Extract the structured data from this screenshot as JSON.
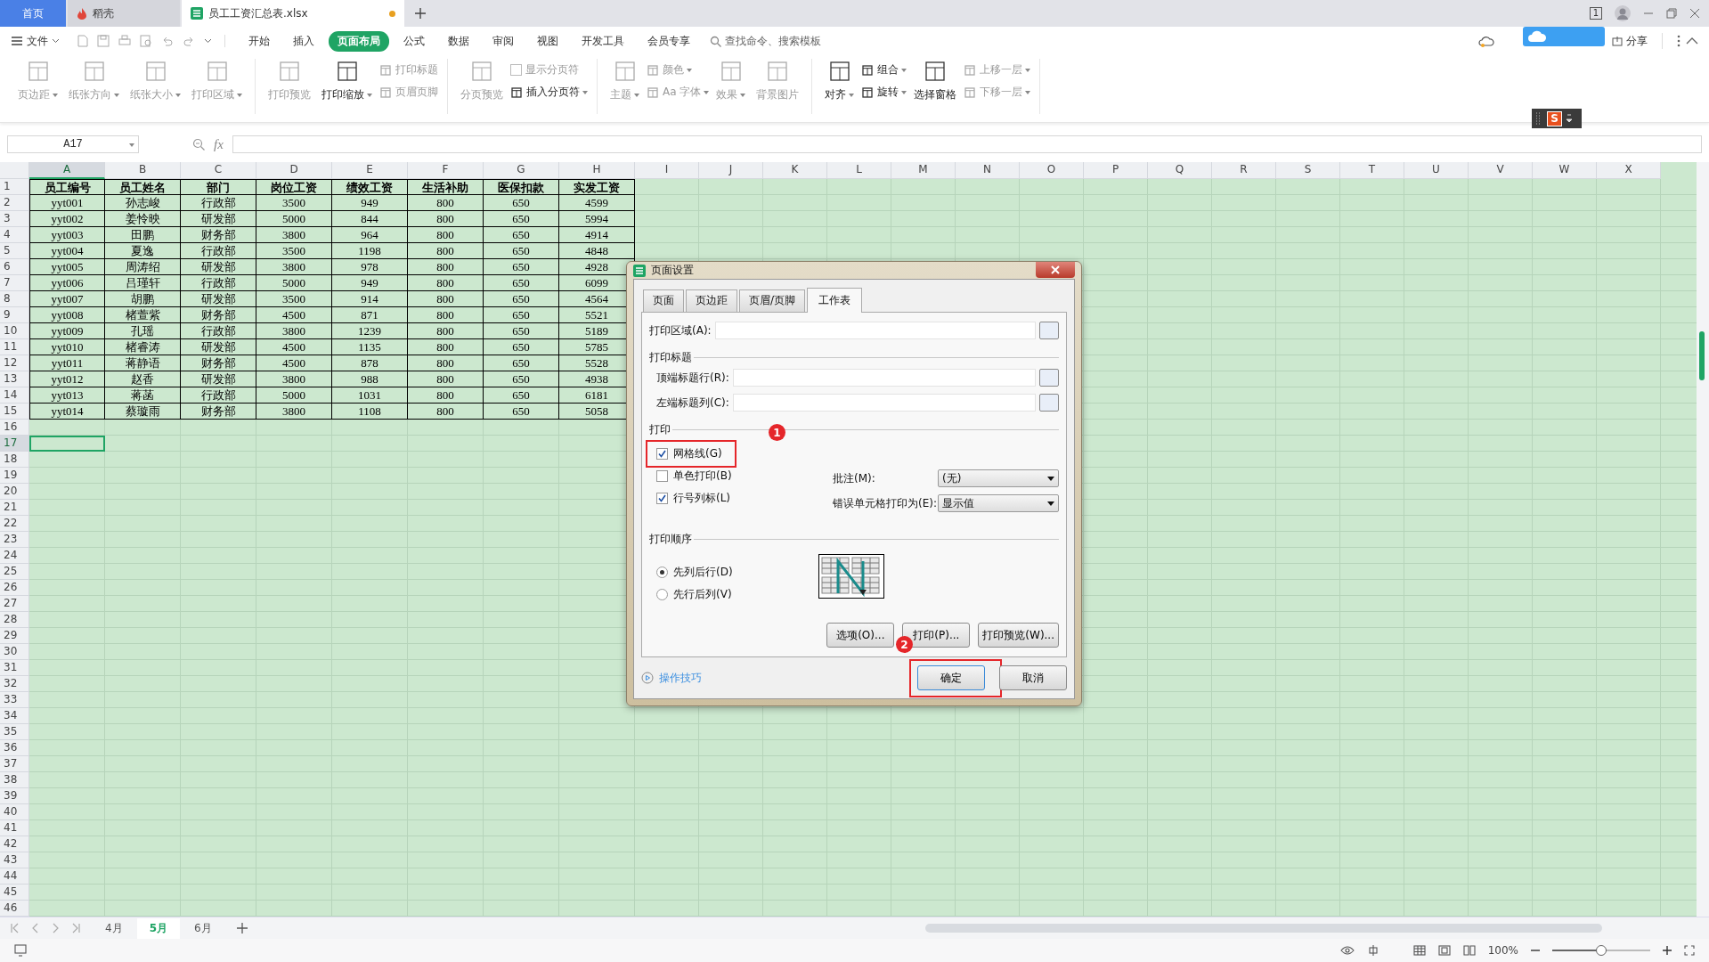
{
  "app_tabs": [
    {
      "label": "首页",
      "kind": "home",
      "selected": false
    },
    {
      "label": "稻壳",
      "kind": "docer",
      "selected": false
    },
    {
      "label": "员工工资汇总表.xlsx",
      "kind": "sheet",
      "selected": true
    }
  ],
  "window_count": "1",
  "menu": {
    "file": "文件",
    "tabs": [
      {
        "label": "开始",
        "selected": false
      },
      {
        "label": "插入",
        "selected": false
      },
      {
        "label": "页面布局",
        "selected": true
      },
      {
        "label": "公式",
        "selected": false
      },
      {
        "label": "数据",
        "selected": false
      },
      {
        "label": "审阅",
        "selected": false
      },
      {
        "label": "视图",
        "selected": false
      },
      {
        "label": "开发工具",
        "selected": false
      },
      {
        "label": "会员专享",
        "selected": false
      }
    ],
    "search_placeholder": "查找命令、搜索模板",
    "share": "分享"
  },
  "ime_badge": "S",
  "ribbon": [
    {
      "items": [
        {
          "kind": "large",
          "label": "页边距",
          "disabled": true,
          "dropdown": true
        },
        {
          "kind": "large",
          "label": "纸张方向",
          "disabled": true,
          "dropdown": true
        },
        {
          "kind": "large",
          "label": "纸张大小",
          "disabled": true,
          "dropdown": true
        },
        {
          "kind": "large",
          "label": "打印区域",
          "disabled": true,
          "dropdown": true
        }
      ]
    },
    {
      "items": [
        {
          "kind": "large",
          "label": "打印预览",
          "disabled": true,
          "dropdown": false
        },
        {
          "kind": "large",
          "label": "打印缩放",
          "disabled": false,
          "dropdown": true
        },
        {
          "kind": "stack",
          "items": [
            {
              "kind": "small",
              "label": "打印标题",
              "disabled": true,
              "dropdown": false
            },
            {
              "kind": "small",
              "label": "页眉页脚",
              "disabled": true,
              "dropdown": false
            }
          ]
        }
      ]
    },
    {
      "items": [
        {
          "kind": "large",
          "label": "分页预览",
          "disabled": true,
          "dropdown": false
        },
        {
          "kind": "stack",
          "items": [
            {
              "kind": "check",
              "label": "显示分页符",
              "disabled": true,
              "dropdown": false,
              "checked": false
            },
            {
              "kind": "small",
              "label": "插入分页符",
              "disabled": false,
              "dropdown": true
            }
          ]
        }
      ]
    },
    {
      "items": [
        {
          "kind": "large",
          "label": "主题",
          "disabled": true,
          "dropdown": true
        },
        {
          "kind": "stack",
          "items": [
            {
              "kind": "small",
              "label": "颜色",
              "disabled": true,
              "dropdown": true
            },
            {
              "kind": "small",
              "label": "Aa 字体",
              "disabled": true,
              "dropdown": true
            }
          ]
        },
        {
          "kind": "large",
          "label": "效果",
          "disabled": true,
          "dropdown": true
        },
        {
          "kind": "large",
          "label": "背景图片",
          "disabled": true,
          "dropdown": false
        }
      ]
    },
    {
      "items": [
        {
          "kind": "large",
          "label": "对齐",
          "disabled": false,
          "dropdown": true
        },
        {
          "kind": "stack",
          "items": [
            {
              "kind": "small",
              "label": "组合",
              "disabled": false,
              "dropdown": true
            },
            {
              "kind": "small",
              "label": "旋转",
              "disabled": false,
              "dropdown": true
            }
          ]
        },
        {
          "kind": "large",
          "label": "选择窗格",
          "disabled": false,
          "dropdown": false
        },
        {
          "kind": "stack",
          "items": [
            {
              "kind": "small",
              "label": "上移一层",
              "disabled": true,
              "dropdown": true
            },
            {
              "kind": "small",
              "label": "下移一层",
              "disabled": true,
              "dropdown": true
            }
          ]
        }
      ]
    }
  ],
  "formula_bar": {
    "cell": "A17",
    "fx": "fx"
  },
  "sheet": {
    "columns": [
      {
        "label": "A",
        "selected": true
      },
      {
        "label": "B",
        "selected": false
      },
      {
        "label": "C",
        "selected": false
      },
      {
        "label": "D",
        "selected": false
      },
      {
        "label": "E",
        "selected": false
      },
      {
        "label": "F",
        "selected": false
      },
      {
        "label": "G",
        "selected": false
      },
      {
        "label": "H",
        "selected": false
      },
      {
        "label": "I",
        "selected": false
      },
      {
        "label": "J",
        "selected": false
      },
      {
        "label": "K",
        "selected": false
      },
      {
        "label": "L",
        "selected": false
      },
      {
        "label": "M",
        "selected": false
      },
      {
        "label": "N",
        "selected": false
      },
      {
        "label": "O",
        "selected": false
      },
      {
        "label": "P",
        "selected": false
      },
      {
        "label": "Q",
        "selected": false
      },
      {
        "label": "R",
        "selected": false
      },
      {
        "label": "S",
        "selected": false
      },
      {
        "label": "T",
        "selected": false
      },
      {
        "label": "U",
        "selected": false
      },
      {
        "label": "V",
        "selected": false
      },
      {
        "label": "W",
        "selected": false
      },
      {
        "label": "X",
        "selected": false
      }
    ],
    "rows": [
      {
        "label": "1",
        "selected": false
      },
      {
        "label": "2",
        "selected": false
      },
      {
        "label": "3",
        "selected": false
      },
      {
        "label": "4",
        "selected": false
      },
      {
        "label": "5",
        "selected": false
      },
      {
        "label": "6",
        "selected": false
      },
      {
        "label": "7",
        "selected": false
      },
      {
        "label": "8",
        "selected": false
      },
      {
        "label": "9",
        "selected": false
      },
      {
        "label": "10",
        "selected": false
      },
      {
        "label": "11",
        "selected": false
      },
      {
        "label": "12",
        "selected": false
      },
      {
        "label": "13",
        "selected": false
      },
      {
        "label": "14",
        "selected": false
      },
      {
        "label": "15",
        "selected": false
      },
      {
        "label": "16",
        "selected": false
      },
      {
        "label": "17",
        "selected": true
      },
      {
        "label": "18",
        "selected": false
      },
      {
        "label": "19",
        "selected": false
      },
      {
        "label": "20",
        "selected": false
      },
      {
        "label": "21",
        "selected": false
      },
      {
        "label": "22",
        "selected": false
      },
      {
        "label": "23",
        "selected": false
      },
      {
        "label": "24",
        "selected": false
      },
      {
        "label": "25",
        "selected": false
      },
      {
        "label": "26",
        "selected": false
      },
      {
        "label": "27",
        "selected": false
      },
      {
        "label": "28",
        "selected": false
      },
      {
        "label": "29",
        "selected": false
      },
      {
        "label": "30",
        "selected": false
      },
      {
        "label": "31",
        "selected": false
      },
      {
        "label": "32",
        "selected": false
      },
      {
        "label": "33",
        "selected": false
      },
      {
        "label": "34",
        "selected": false
      },
      {
        "label": "35",
        "selected": false
      },
      {
        "label": "36",
        "selected": false
      },
      {
        "label": "37",
        "selected": false
      },
      {
        "label": "38",
        "selected": false
      },
      {
        "label": "39",
        "selected": false
      },
      {
        "label": "40",
        "selected": false
      },
      {
        "label": "41",
        "selected": false
      },
      {
        "label": "42",
        "selected": false
      },
      {
        "label": "43",
        "selected": false
      },
      {
        "label": "44",
        "selected": false
      },
      {
        "label": "45",
        "selected": false
      },
      {
        "label": "46",
        "selected": false
      }
    ],
    "table": [
      [
        "员工编号",
        "员工姓名",
        "部门",
        "岗位工资",
        "绩效工资",
        "生活补助",
        "医保扣款",
        "实发工资"
      ],
      [
        "yyt001",
        "孙志峻",
        "行政部",
        "3500",
        "949",
        "800",
        "650",
        "4599"
      ],
      [
        "yyt002",
        "姜怜映",
        "研发部",
        "5000",
        "844",
        "800",
        "650",
        "5994"
      ],
      [
        "yyt003",
        "田鹏",
        "财务部",
        "3800",
        "964",
        "800",
        "650",
        "4914"
      ],
      [
        "yyt004",
        "夏逸",
        "行政部",
        "3500",
        "1198",
        "800",
        "650",
        "4848"
      ],
      [
        "yyt005",
        "周涛绍",
        "研发部",
        "3800",
        "978",
        "800",
        "650",
        "4928"
      ],
      [
        "yyt006",
        "吕瑾轩",
        "行政部",
        "5000",
        "949",
        "800",
        "650",
        "6099"
      ],
      [
        "yyt007",
        "胡鹏",
        "研发部",
        "3500",
        "914",
        "800",
        "650",
        "4564"
      ],
      [
        "yyt008",
        "楮萱紫",
        "财务部",
        "4500",
        "871",
        "800",
        "650",
        "5521"
      ],
      [
        "yyt009",
        "孔瑶",
        "行政部",
        "3800",
        "1239",
        "800",
        "650",
        "5189"
      ],
      [
        "yyt010",
        "楮睿涛",
        "研发部",
        "4500",
        "1135",
        "800",
        "650",
        "5785"
      ],
      [
        "yyt011",
        "蒋静语",
        "财务部",
        "4500",
        "878",
        "800",
        "650",
        "5528"
      ],
      [
        "yyt012",
        "赵香",
        "研发部",
        "3800",
        "988",
        "800",
        "650",
        "4938"
      ],
      [
        "yyt013",
        "蒋菡",
        "行政部",
        "5000",
        "1031",
        "800",
        "650",
        "6181"
      ],
      [
        "yyt014",
        "蔡璇雨",
        "财务部",
        "3800",
        "1108",
        "800",
        "650",
        "5058"
      ]
    ]
  },
  "sheet_tabs": [
    {
      "label": "4月",
      "selected": false
    },
    {
      "label": "5月",
      "selected": true
    },
    {
      "label": "6月",
      "selected": false
    }
  ],
  "status_bar": {
    "zoom": "100%",
    "zoom_slider": {
      "level": 0.5
    }
  },
  "dialog": {
    "title": "页面设置",
    "tabs": [
      {
        "label": "页面",
        "selected": false
      },
      {
        "label": "页边距",
        "selected": false
      },
      {
        "label": "页眉/页脚",
        "selected": false
      },
      {
        "label": "工作表",
        "selected": true
      }
    ],
    "print_area": "打印区域(A):",
    "titles_section": "打印标题",
    "title_fields": [
      "顶端标题行(R):",
      "左端标题列(C):"
    ],
    "print_section": "打印",
    "checks": [
      {
        "label": "网格线(G)",
        "checked": true,
        "callout": "1"
      },
      {
        "label": "单色打印(B)",
        "checked": false
      },
      {
        "label": "行号列标(L)",
        "checked": true
      }
    ],
    "selects": [
      {
        "label": "批注(M):",
        "value": "(无)"
      },
      {
        "label": "错误单元格打印为(E):",
        "value": "显示值"
      }
    ],
    "order_section": "打印顺序",
    "order": [
      {
        "label": "先列后行(D)",
        "selected": true
      },
      {
        "label": "先行后列(V)",
        "selected": false
      }
    ],
    "buttons": [
      "选项(O)...",
      "打印(P)...",
      "打印预览(W)..."
    ],
    "tips": "操作技巧",
    "ok": {
      "label": "确定",
      "callout": "2"
    },
    "cancel": "取消"
  }
}
